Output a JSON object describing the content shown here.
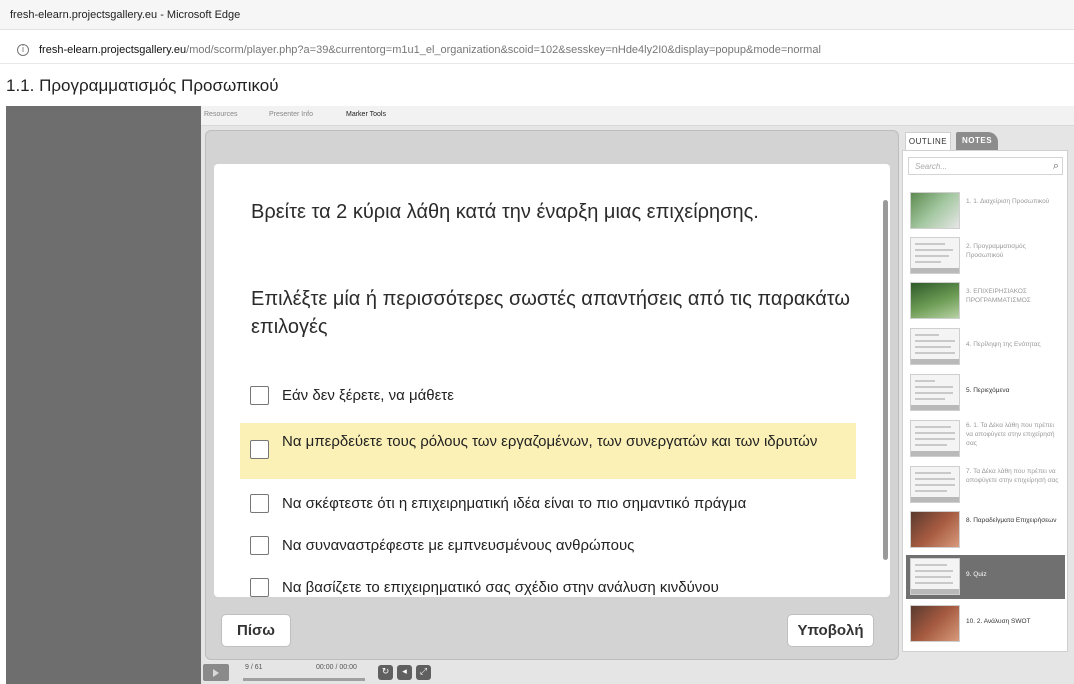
{
  "window": {
    "title": "fresh-elearn.projectsgallery.eu - Microsoft Edge"
  },
  "address": {
    "host": "fresh-elearn.projectsgallery.eu",
    "path": "/mod/scorm/player.php?a=39&currentorg=m1u1_el_organization&scoid=102&sesskey=nHde4ly2I0&display=popup&mode=normal"
  },
  "page": {
    "title": "1.1. Προγραμματισμός Προσωπικού"
  },
  "player": {
    "top_tabs": [
      "Resources",
      "Presenter Info",
      "Marker Tools"
    ],
    "question": {
      "title": "Βρείτε τα 2 κύρια λάθη κατά την έναρξη μιας επιχείρησης.",
      "instruction": "Επιλέξτε μία ή περισσότερες σωστές απαντήσεις από τις παρακάτω επιλογές",
      "options": [
        "Εάν δεν ξέρετε, να μάθετε",
        "Να μπερδεύετε τους ρόλους των εργαζομένων, των συνεργατών και των ιδρυτών",
        "Να σκέφτεστε ότι η επιχειρηματική ιδέα είναι το πιο σημαντικό πράγμα",
        "Να συναναστρέφεστε  με εμπνευσμένους ανθρώπους",
        "Να βασίζετε το επιχειρηματικό σας σχέδιο στην ανάλυση κινδύνου"
      ],
      "highlighted_option": 1
    },
    "buttons": {
      "back": "Πίσω",
      "submit": "Υποβολή"
    },
    "controls": {
      "slide_counter": "9 / 61",
      "time": "00:00 / 00:00"
    }
  },
  "sidebar": {
    "tabs": {
      "outline": "OUTLINE",
      "notes": "NOTES"
    },
    "search_placeholder": "Search...",
    "items": [
      {
        "label": "1. 1. Διαχείριση Προσωπικού"
      },
      {
        "label": "2. Προγραμματισμός Προσωπικού"
      },
      {
        "label": "3. ΕΠΙΧΕΙΡΗΣΙΑΚΟΣ ΠΡΟΓΡΑΜΜΑΤΙΣΜΟΣ"
      },
      {
        "label": "4. Περίληψη της Ενότητας"
      },
      {
        "label": "5. Περιεχόμενα"
      },
      {
        "label": "6. 1. Τα Δέκα λάθη που πρέπει να αποφύγετε στην επιχείρησή σας"
      },
      {
        "label": "7. Τα Δέκα λάθη που πρέπει να αποφύγετε στην επιχείρησή σας"
      },
      {
        "label": "8. Παραδείγματα Επιχειρήσεων"
      },
      {
        "label": "9. Quiz"
      },
      {
        "label": "10. 2. Ανάλυση SWOT"
      }
    ],
    "active_item": 8
  }
}
